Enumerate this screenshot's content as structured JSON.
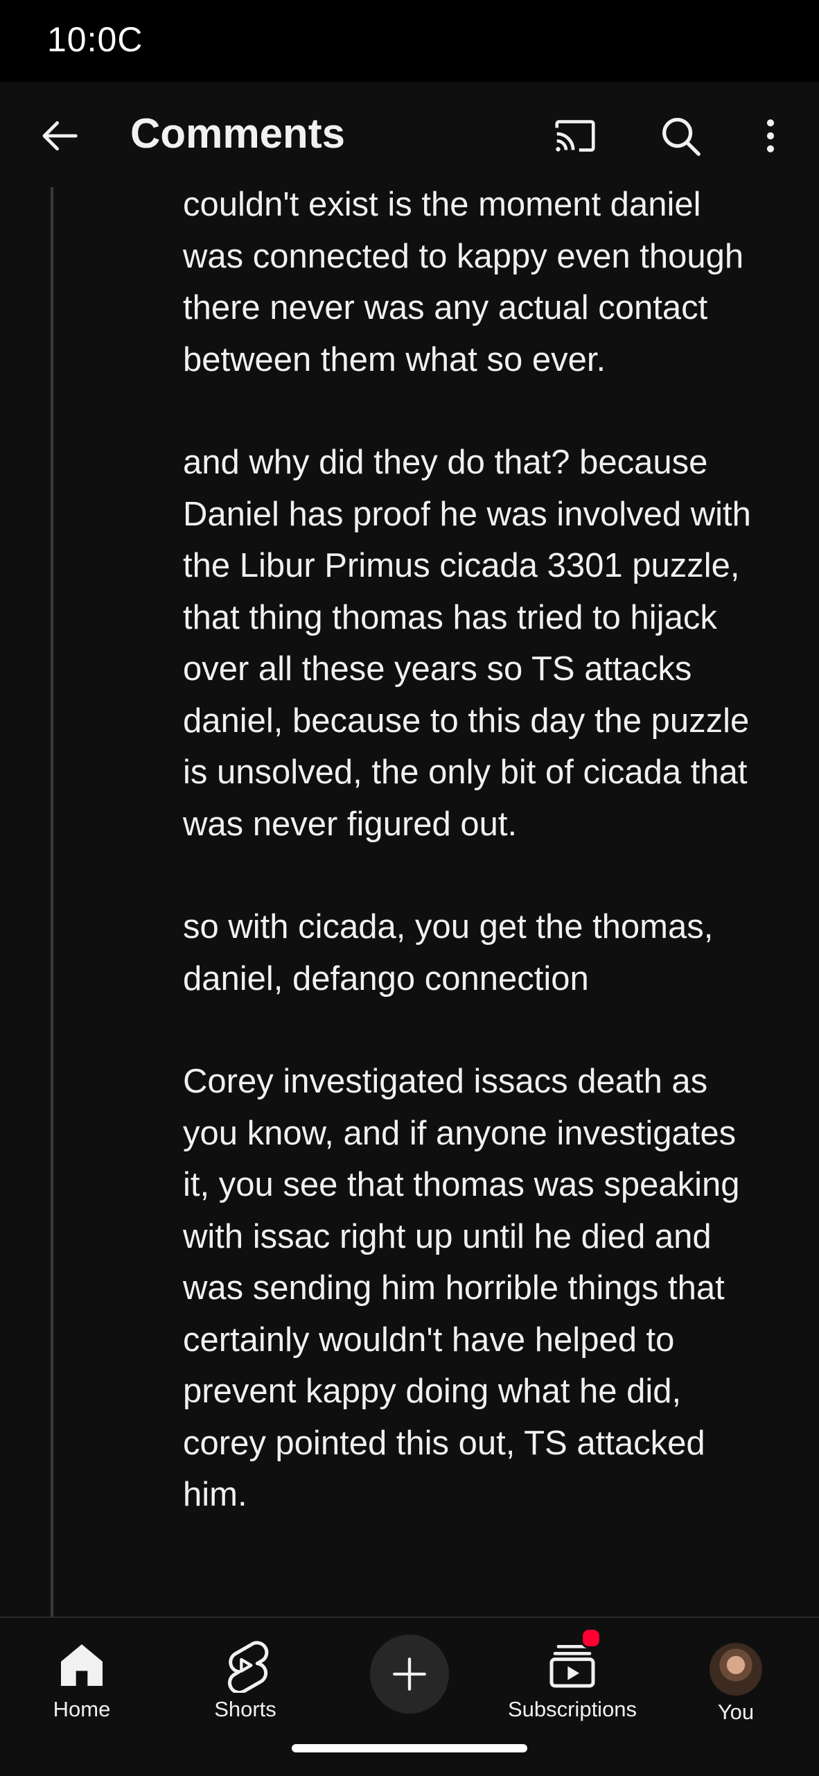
{
  "status_bar": {
    "time": "10:0C"
  },
  "header": {
    "title": "Comments",
    "back_icon": "arrow-left-icon",
    "cast_icon": "cast-icon",
    "search_icon": "search-icon",
    "more_icon": "more-vertical-icon"
  },
  "comment": {
    "paragraphs": [
      "couldn't exist is the moment daniel was connected to kappy even though there never was any actual contact between them what so ever.",
      "and why did they do that? because Daniel has proof he was involved with the Libur Primus cicada 3301 puzzle, that thing thomas has tried to hijack over all these years so TS attacks daniel, because to this day the puzzle is unsolved, the only bit of cicada that was never figured out.",
      "so with cicada, you get the thomas, daniel, defango connection",
      "Corey investigated issacs death as you know, and if anyone investigates it, you see that thomas was speaking with issac right up until he died and was sending him horrible things that certainly wouldn't have helped to prevent kappy doing what he did, corey pointed this out, TS attacked him."
    ]
  },
  "bottom_nav": {
    "home_label": "Home",
    "shorts_label": "Shorts",
    "create_icon": "plus-icon",
    "subscriptions_label": "Subscriptions",
    "you_label": "You"
  },
  "colors": {
    "background": "#0f0f0f",
    "text": "#f1f1f1",
    "notification_dot": "#ff0033"
  }
}
